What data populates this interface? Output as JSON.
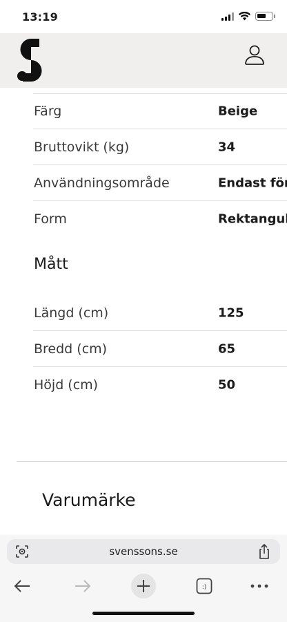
{
  "status_bar": {
    "time": "13:19"
  },
  "header": {
    "logo_icon": "svenssons-s-logo-icon",
    "account_icon": "user-icon"
  },
  "specs": [
    {
      "label": "Färg",
      "value": "Beige"
    },
    {
      "label": "Bruttovikt (kg)",
      "value": "34"
    },
    {
      "label": "Användningsområde",
      "value": "Endast för"
    },
    {
      "label": "Form",
      "value": "Rektangul"
    }
  ],
  "dimensions": {
    "heading": "Mått",
    "rows": [
      {
        "label": "Längd (cm)",
        "value": "125"
      },
      {
        "label": "Bredd (cm)",
        "value": "65"
      },
      {
        "label": "Höjd (cm)",
        "value": "50"
      }
    ]
  },
  "brand_section": {
    "heading": "Varumärke"
  },
  "browser": {
    "url": "svenssons.se",
    "tab_count_glyph": ":)",
    "icons": [
      "reader-icon",
      "share-icon",
      "back-arrow-icon",
      "forward-arrow-icon",
      "new-tab-icon",
      "tabs-icon",
      "more-icon"
    ]
  }
}
